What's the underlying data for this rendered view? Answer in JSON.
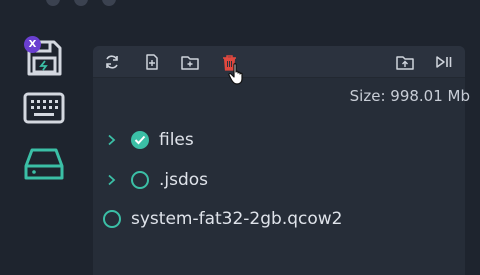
{
  "sidebar": {
    "disk_badge": "X"
  },
  "toolbar": {
    "icons": [
      "refresh-icon",
      "new-file-icon",
      "new-folder-icon",
      "delete-icon",
      "upload-folder-icon",
      "play-pause-icon"
    ]
  },
  "size_label": "Size: 998.01 Mb",
  "tree": {
    "items": [
      {
        "label": "files",
        "expandable": true,
        "checked": true
      },
      {
        "label": ".jsdos",
        "expandable": true,
        "checked": false
      },
      {
        "label": "system-fat32-2gb.qcow2",
        "expandable": false,
        "checked": false
      }
    ]
  },
  "colors": {
    "accent": "#3bbfa6",
    "delete": "#e0483f",
    "badge": "#6a3fd0",
    "background": "#1e242e",
    "panel": "#262d38"
  }
}
